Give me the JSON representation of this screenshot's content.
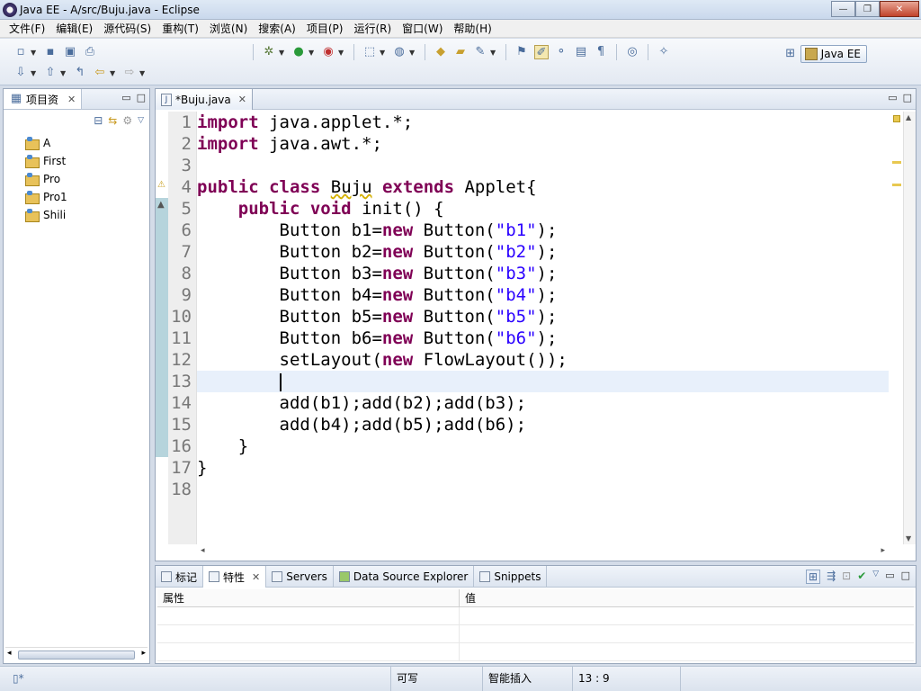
{
  "window": {
    "title": "Java EE  - A/src/Buju.java  - Eclipse",
    "minimize": "—",
    "maximize": "❐",
    "close": "✕"
  },
  "menu": [
    "文件(F)",
    "编辑(E)",
    "源代码(S)",
    "重构(T)",
    "浏览(N)",
    "搜索(A)",
    "项目(P)",
    "运行(R)",
    "窗口(W)",
    "帮助(H)"
  ],
  "toolbar": {
    "perspective_label": "Java EE"
  },
  "explorer": {
    "tab_label": "项目资",
    "close_glyph": "✕",
    "projects": [
      "A",
      "First",
      "Pro",
      "Pro1",
      "Shili"
    ]
  },
  "editor": {
    "tab_label": "*Buju.java",
    "close_glyph": "✕",
    "line_numbers": [
      "1",
      "2",
      "3",
      "4",
      "5",
      "6",
      "7",
      "8",
      "9",
      "10",
      "11",
      "12",
      "13",
      "14",
      "15",
      "16",
      "17",
      "18"
    ]
  },
  "code": {
    "l1_kw": "import",
    "l1_rest": " java.applet.*;",
    "l2_kw": "import",
    "l2_rest": " java.awt.*;",
    "l4_kw1": "public",
    "l4_kw2": "class",
    "l4_name": "Buju",
    "l4_kw3": "extends",
    "l4_rest": " Applet{",
    "l5_kw1": "public",
    "l5_kw2": "void",
    "l5_rest": " init() {",
    "buttons": [
      {
        "decl": "Button b1=",
        "kw": "new",
        "ctor": " Button(",
        "str": "\"b1\"",
        "end": ");"
      },
      {
        "decl": "Button b2=",
        "kw": "new",
        "ctor": " Button(",
        "str": "\"b2\"",
        "end": ");"
      },
      {
        "decl": "Button b3=",
        "kw": "new",
        "ctor": " Button(",
        "str": "\"b3\"",
        "end": ");"
      },
      {
        "decl": "Button b4=",
        "kw": "new",
        "ctor": " Button(",
        "str": "\"b4\"",
        "end": ");"
      },
      {
        "decl": "Button b5=",
        "kw": "new",
        "ctor": " Button(",
        "str": "\"b5\"",
        "end": ");"
      },
      {
        "decl": "Button b6=",
        "kw": "new",
        "ctor": " Button(",
        "str": "\"b6\"",
        "end": ");"
      }
    ],
    "l12_a": "setLayout(",
    "l12_kw": "new",
    "l12_b": " FlowLayout());",
    "l14": "add(b1);add(b2);add(b3);",
    "l15": "add(b4);add(b5);add(b6);",
    "l16": "}",
    "l17": "}"
  },
  "bottom": {
    "tabs": [
      {
        "label": "标记",
        "close": ""
      },
      {
        "label": "特性",
        "close": "✕"
      },
      {
        "label": "Servers",
        "close": ""
      },
      {
        "label": "Data Source Explorer",
        "close": ""
      },
      {
        "label": "Snippets",
        "close": ""
      }
    ],
    "col_property": "属性",
    "col_value": "值"
  },
  "status": {
    "writable": "可写",
    "insert_mode": "智能插入",
    "position": "13 : 9"
  },
  "colors": {
    "keyword": "#7f0055",
    "string": "#2a00ff",
    "current_line": "#e8f0fb"
  }
}
